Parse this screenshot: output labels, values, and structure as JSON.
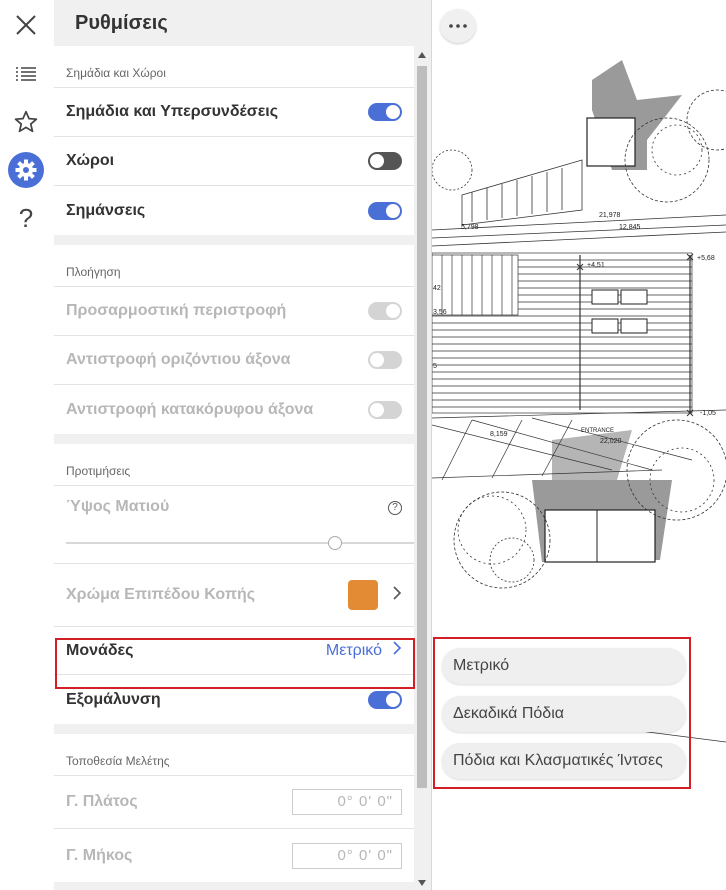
{
  "panel": {
    "title": "Ρυθμίσεις"
  },
  "rail": {
    "icons": [
      "close-icon",
      "list-icon",
      "star-icon",
      "gear-icon",
      "help-icon"
    ],
    "help_glyph": "?"
  },
  "sections": {
    "markers": {
      "header": "Σημάδια και Χώροι",
      "rows": [
        {
          "label": "Σημάδια και Υπερσυνδέσεις",
          "on": true
        },
        {
          "label": "Χώροι",
          "on": false
        },
        {
          "label": "Σημάνσεις",
          "on": true
        }
      ]
    },
    "navigation": {
      "header": "Πλοήγηση",
      "rows": [
        {
          "label": "Προσαρμοστική περιστροφή",
          "on": true
        },
        {
          "label": "Αντιστροφή οριζόντιου άξονα",
          "on": false
        },
        {
          "label": "Αντιστροφή κατακόρυφου άξονα",
          "on": false
        }
      ]
    },
    "preferences": {
      "header": "Προτιμήσεις",
      "eye_height_label": "Ύψος Ματιού",
      "eye_height_level": 0.8,
      "help_glyph": "?",
      "cut_plane_label": "Χρώμα Επιπέδου Κοπής",
      "cut_plane_color": "#e38a35",
      "units_label": "Μονάδες",
      "units_value": "Μετρικό",
      "smoothing_label": "Εξομάλυνση",
      "smoothing_on": true
    },
    "location": {
      "header": "Τοποθεσία Μελέτης",
      "latitude_label": "Γ. Πλάτος",
      "latitude_value": "0°  0'  0\"",
      "longitude_label": "Γ. Μήκος",
      "longitude_value": "0°  0'  0\""
    }
  },
  "drawing": {
    "labels": [
      "21,978",
      "5,798",
      "12,845",
      "+4,51",
      "+5,68",
      "3,56",
      "5",
      "42",
      "-1,05",
      "8,159",
      "ENTRANCE",
      "22,020"
    ]
  },
  "units_menu": {
    "options": [
      "Μετρικό",
      "Δεκαδικά Πόδια",
      "Πόδια και Κλασματικές Ίντσες"
    ]
  },
  "colors": {
    "accent": "#4a6fd6",
    "highlight": "#d21f26"
  }
}
